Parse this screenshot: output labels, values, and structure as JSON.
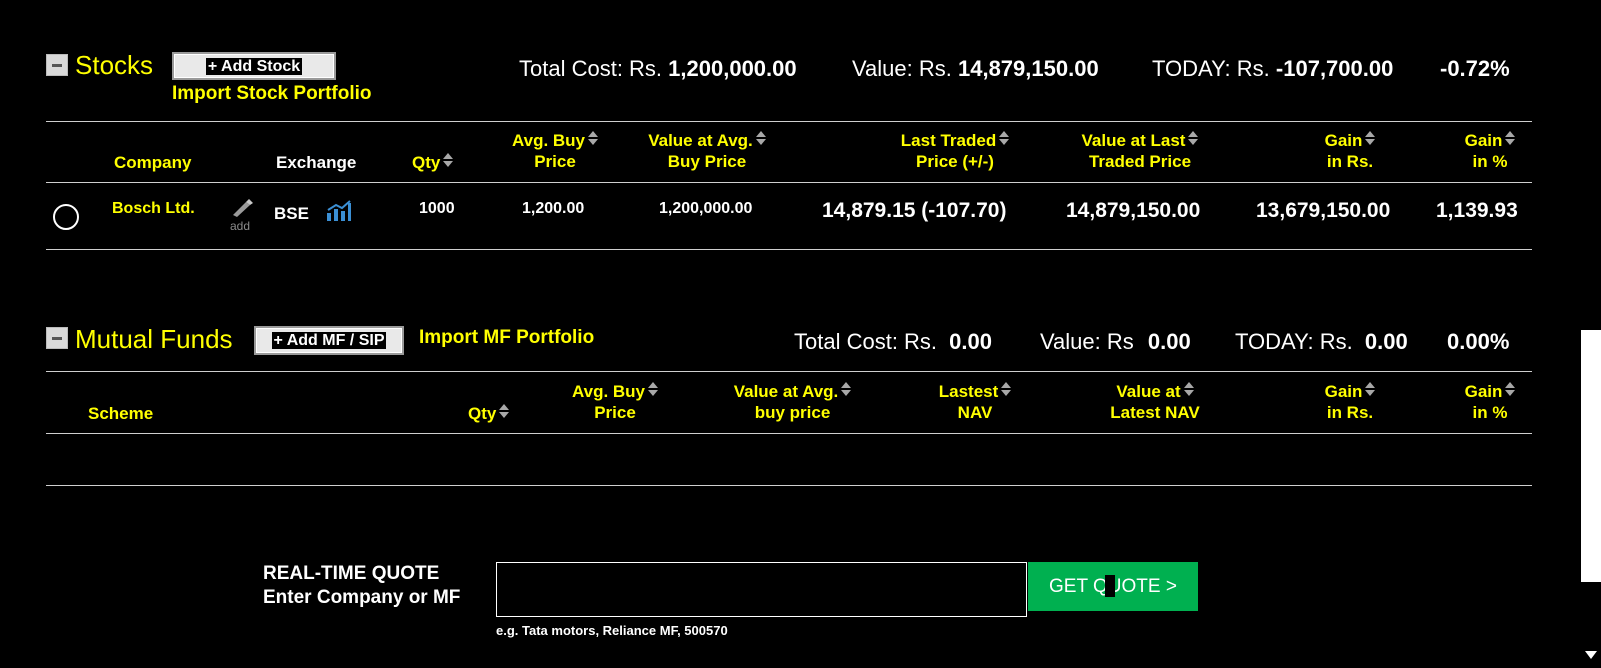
{
  "stocks": {
    "title": "Stocks",
    "add_button": "+ Add Stock",
    "import_link": "Import Stock Portfolio",
    "summary": {
      "total_cost_label": "Total Cost: Rs.",
      "total_cost_value": "1,200,000.00",
      "value_label": "Value: Rs.",
      "value_value": "14,879,150.00",
      "today_label": "TODAY: Rs.",
      "today_value": "-107,700.00",
      "today_pct": "-0.72%"
    },
    "columns": {
      "company": "Company",
      "exchange": "Exchange",
      "qty": "Qty",
      "avg_buy_1": "Avg. Buy",
      "avg_buy_2": "Price",
      "val_avg_1": "Value at Avg.",
      "val_avg_2": "Buy Price",
      "ltp_1": "Last Traded",
      "ltp_2": "Price (+/-)",
      "val_ltp_1": "Value at Last",
      "val_ltp_2": "Traded Price",
      "gain_rs_1": "Gain",
      "gain_rs_2": "in Rs.",
      "gain_pct_1": "Gain",
      "gain_pct_2": "in %"
    },
    "rows": [
      {
        "company": "Bosch Ltd.",
        "add_label": "add",
        "exchange": "BSE",
        "qty": "1000",
        "avg_buy_price": "1,200.00",
        "value_at_avg": "1,200,000.00",
        "last_traded": "14,879.15 (-107.70)",
        "value_at_last": "14,879,150.00",
        "gain_rs": "13,679,150.00",
        "gain_pct": "1,139.93"
      }
    ]
  },
  "mutual_funds": {
    "title": "Mutual Funds",
    "add_button": "+ Add MF / SIP",
    "import_link": "Import MF Portfolio",
    "summary": {
      "total_cost_label": "Total Cost: Rs.",
      "total_cost_value": "0.00",
      "value_label": "Value: Rs",
      "value_value": "0.00",
      "today_label": "TODAY: Rs.",
      "today_value": "0.00",
      "today_pct": "0.00%"
    },
    "columns": {
      "scheme": "Scheme",
      "qty": "Qty",
      "avg_buy_1": "Avg. Buy",
      "avg_buy_2": "Price",
      "val_avg_1": "Value at Avg.",
      "val_avg_2": "buy price",
      "nav_1": "Lastest",
      "nav_2": "NAV",
      "val_nav_1": "Value at",
      "val_nav_2": "Latest NAV",
      "gain_rs_1": "Gain",
      "gain_rs_2": "in Rs.",
      "gain_pct_1": "Gain",
      "gain_pct_2": "in %"
    }
  },
  "quote": {
    "label_line1": "REAL-TIME QUOTE",
    "label_line2": "Enter Company or MF",
    "input_value": "",
    "button": "GET QUOTE >",
    "hint": "e.g. Tata motors, Reliance MF, 500570"
  },
  "colors": {
    "background": "#000000",
    "accent_yellow": "#ffff00",
    "button_green": "#00b050"
  }
}
